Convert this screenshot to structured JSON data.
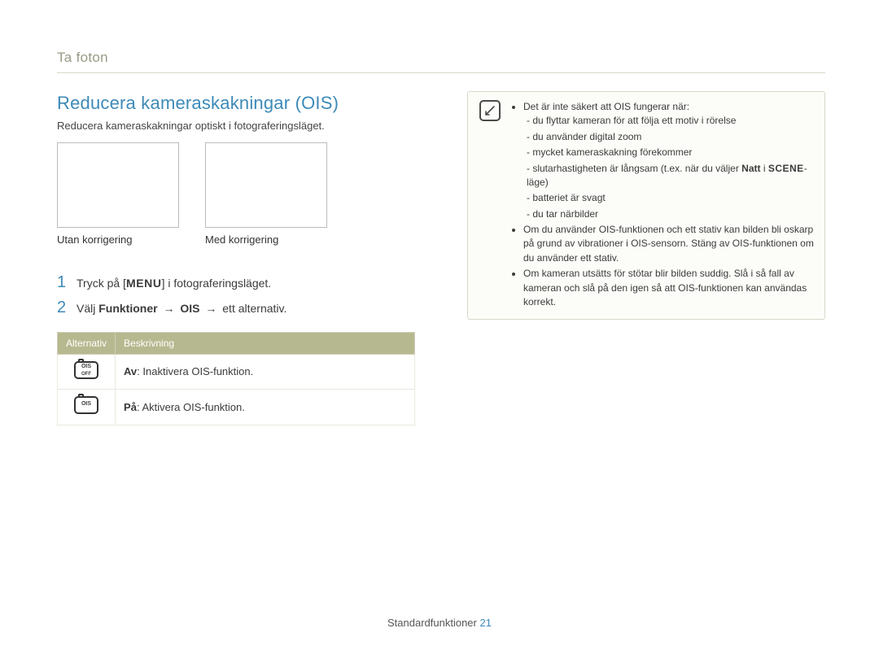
{
  "header": {
    "title": "Ta foton"
  },
  "section": {
    "title": "Reducera kameraskakningar (OIS)",
    "subtitle": "Reducera kameraskakningar optiskt i fotograferingsläget."
  },
  "images": {
    "without": "Utan korrigering",
    "with": "Med korrigering"
  },
  "steps": {
    "one_a": "Tryck på [",
    "one_menu": "MENU",
    "one_b": "] i fotograferingsläget.",
    "two_a": "Välj ",
    "two_funk": "Funktioner",
    "two_arrow": "→",
    "two_ois": "OIS",
    "two_b": " ett alternativ."
  },
  "table": {
    "head_alt": "Alternativ",
    "head_desc": "Beskrivning",
    "row_off": {
      "label": "Av",
      "desc": ": Inaktivera OIS-funktion."
    },
    "row_on": {
      "label": "På",
      "desc": ": Aktivera OIS-funktion."
    },
    "icon_ois": "OIS",
    "icon_off": "OFF"
  },
  "note": {
    "b1": "Det är inte säkert att OIS fungerar när:",
    "b1_1": "du flyttar kameran för att följa ett motiv i rörelse",
    "b1_2": "du använder digital zoom",
    "b1_3": "mycket kameraskakning förekommer",
    "b1_4a": "slutarhastigheten är långsam (t.ex. när du väljer ",
    "b1_4_natt": "Natt",
    "b1_4b": " i ",
    "b1_4_scene": "SCENE",
    "b1_4c": "-läge)",
    "b1_5": "batteriet är svagt",
    "b1_6": "du tar närbilder",
    "b2": "Om du använder OIS-funktionen och ett stativ kan bilden bli oskarp på grund av vibrationer i OIS-sensorn. Stäng av OIS-funktionen om du använder ett stativ.",
    "b3": "Om kameran utsätts för stötar blir bilden suddig. Slå i så fall av kameran och slå på den igen så att OIS-funktionen kan användas korrekt."
  },
  "footer": {
    "label": "Standardfunktioner",
    "page": "21"
  }
}
